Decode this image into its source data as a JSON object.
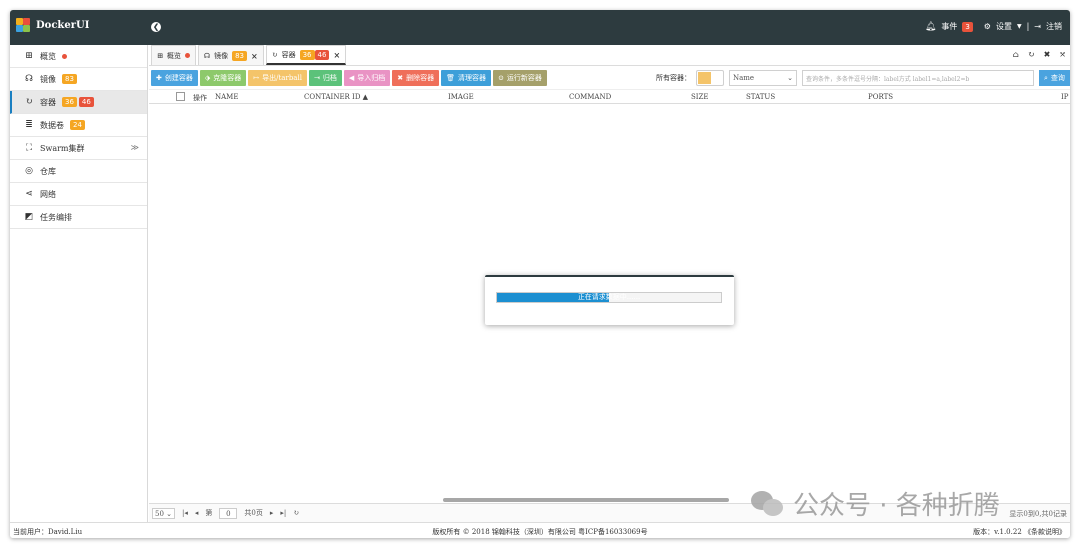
{
  "brand": {
    "name": "DockerUI"
  },
  "topbar": {
    "events_label": "事件",
    "events_count": "3",
    "settings_label": "设置",
    "separator": "|",
    "logout_label": "注销"
  },
  "sidebar": {
    "items": [
      {
        "label": "概览",
        "badge1": "",
        "badge2": "",
        "icon": "windows-icon"
      },
      {
        "label": "镜像",
        "badge1": "83",
        "badge2": "",
        "icon": "headphones-icon"
      },
      {
        "label": "容器",
        "badge1": "36",
        "badge2": "46",
        "icon": "refresh-circle-icon"
      },
      {
        "label": "数据卷",
        "badge1": "24",
        "badge2": "",
        "icon": "database-icon"
      },
      {
        "label": "Swarm集群",
        "badge1": "",
        "badge2": "",
        "icon": "sitemap-icon"
      },
      {
        "label": "仓库",
        "badge1": "",
        "badge2": "",
        "icon": "globe-icon"
      },
      {
        "label": "网络",
        "badge1": "",
        "badge2": "",
        "icon": "share-icon"
      },
      {
        "label": "任务编排",
        "badge1": "",
        "badge2": "",
        "icon": "puzzle-icon"
      }
    ]
  },
  "tabs": [
    {
      "label": "概览"
    },
    {
      "label": "镜像",
      "badge1": "83"
    },
    {
      "label": "容器",
      "badge1": "36",
      "badge2": "46"
    }
  ],
  "toolbar": {
    "buttons": [
      {
        "label": "创建容器",
        "icon": "plus-icon"
      },
      {
        "label": "克隆容器",
        "icon": "tag-icon"
      },
      {
        "label": "导出/tarball",
        "icon": "export-icon"
      },
      {
        "label": "归档",
        "icon": "archive-icon"
      },
      {
        "label": "导入归档",
        "icon": "import-icon"
      },
      {
        "label": "删除容器",
        "icon": "times-icon"
      },
      {
        "label": "清理容器",
        "icon": "trash-icon"
      },
      {
        "label": "运行新容器",
        "icon": "play-circle-icon"
      }
    ],
    "all_containers_label": "所有容器：",
    "filter_select_value": "Name",
    "query_placeholder": "查询条件，多条件逗号分隔：label方式 label1=a,label2=b",
    "query_button": "查询"
  },
  "table": {
    "columns": [
      "操作",
      "NAME",
      "CONTAINER ID ▲",
      "IMAGE",
      "COMMAND",
      "SIZE",
      "STATUS",
      "PORTS",
      "IP"
    ]
  },
  "modal": {
    "progress_text": "正在请求数据中......",
    "progress_fraction": 0.5
  },
  "pager": {
    "page_size": "50",
    "page_prefix": "第",
    "page_value": "0",
    "page_suffix": "共0页",
    "info": "显示0到0,共0记录"
  },
  "footer": {
    "user": "当前用户：David.Liu",
    "copyright": "版权所有 © 2018 锦翰科技（深圳）有限公司 粤ICP备16033069号",
    "version": "版本：v.1.0.22 《条款说明》"
  },
  "watermark": {
    "text": "公众号 · 各种折腾"
  },
  "colors": {
    "topbar": "#2d3b3f",
    "accent_blue": "#4aa3df",
    "badge_orange": "#f5a623",
    "badge_red": "#e8533b"
  }
}
